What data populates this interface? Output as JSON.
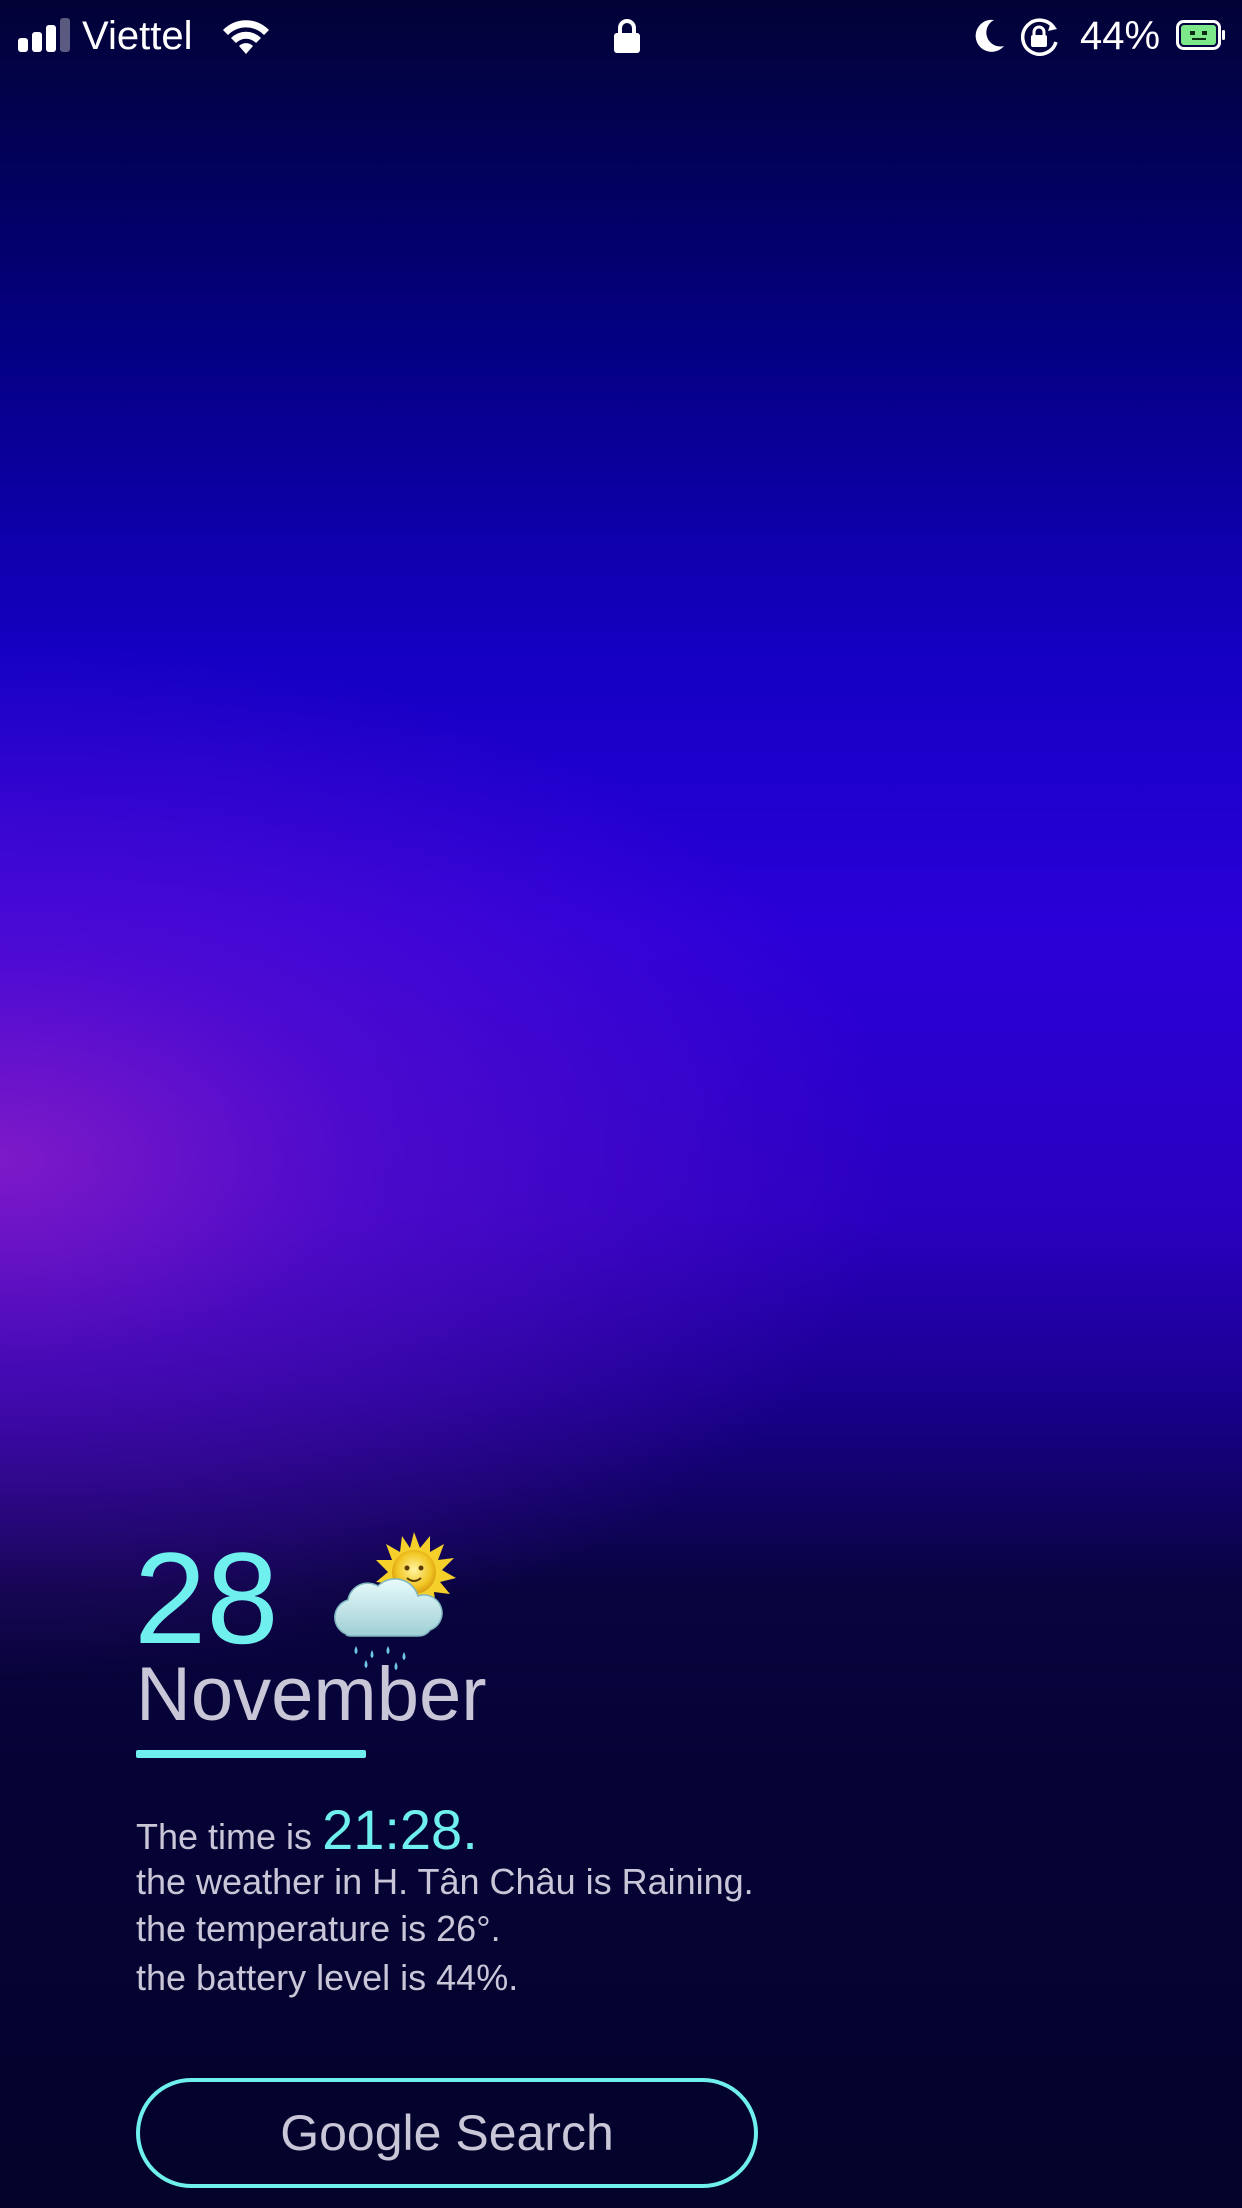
{
  "status_bar": {
    "carrier": "Viettel",
    "battery_percent": "44%",
    "signal_bars_filled": 3,
    "signal_bars_total": 4,
    "battery_level": 0.44,
    "icons": [
      "signal-icon",
      "wifi-icon",
      "lock-icon",
      "moon-icon",
      "rotation-lock-icon",
      "battery-icon"
    ]
  },
  "widget": {
    "day": "28",
    "month": "November",
    "weather_icon": "sun-behind-rain-cloud",
    "time_prefix": "The time is",
    "time": "21:28.",
    "weather_line": "the weather in H. Tân Châu is Raining.",
    "temperature_line": "the temperature is 26°.",
    "battery_line": "the battery level is 44%.",
    "search_label": "Google Search"
  },
  "colors": {
    "accent": "#6ff0ee",
    "text": "#c9c6d8",
    "background_top": "#020236",
    "background_mid": "#2a00d8",
    "background_bottom": "#04032b"
  }
}
